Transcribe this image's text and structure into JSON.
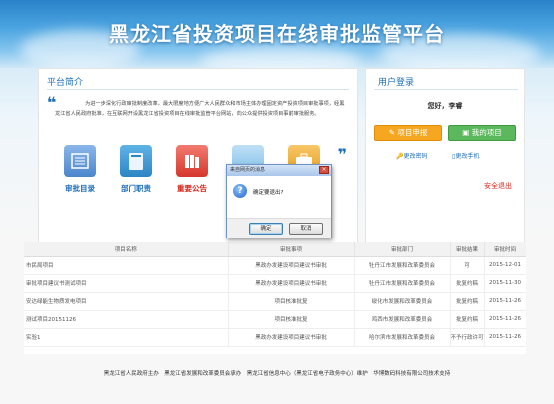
{
  "header": {
    "title": "黑龙江省投资项目在线审批监管平台"
  },
  "intro": {
    "title": "平台简介",
    "text": "为进一步深化行政审批制度改革，最大限度地方便广大人民群众和市场主体办理固定资产投资项目审批事项，经黑龙江省人民政府批准，在互联网开设黑龙江省投资项目在线审批监管平台网站，向公众提供投资项目事前审批服务。",
    "icons": [
      {
        "label": "审批目录",
        "color": "#3b82d1",
        "icon": "catalog-icon"
      },
      {
        "label": "部门职责",
        "color": "#2d9ad6",
        "icon": "book-icon"
      },
      {
        "label": "重要公告",
        "color": "#e0443a",
        "icon": "notice-icon"
      },
      {
        "label": "",
        "color": "#6fb6e6",
        "icon": "partial-icon"
      },
      {
        "label": "",
        "color": "#f2b134",
        "icon": "briefcase-icon"
      }
    ]
  },
  "user": {
    "title": "用户登录",
    "greeting": "您好，李睿",
    "apply_label": "项目申报",
    "my_projects_label": "我的项目",
    "change_password": "更改密码",
    "change_phone": "更改手机",
    "logout": "安全退出"
  },
  "table": {
    "headers": [
      "项目名称",
      "审批事项",
      "审批部门",
      "审批结果",
      "审批时间"
    ],
    "rows": [
      [
        "市民局项目",
        "黑政办发建设项目建议书审批",
        "牡丹江市发展和改革委员会",
        "可",
        "2015-12-01"
      ],
      [
        "审批项目建议书测试项目",
        "黑政办发建设项目建议书审批",
        "牡丹江市发展和改革委员会",
        "批复约稿",
        "2015-11-30"
      ],
      [
        "安达绿能生物质发电项目",
        "项目核准批复",
        "绥化市发展和改革委员会",
        "批复约稿",
        "2015-11-26"
      ],
      [
        "测试项目20151126",
        "项目核准批复",
        "鸡西市发展和改革委员会",
        "批复约稿",
        "2015-11-26"
      ],
      [
        "实验1",
        "黑政办发建设项目建议书审批",
        "哈尔滨市发展和改革委员会",
        "不予行政许可",
        "2015-11-26"
      ]
    ]
  },
  "footer": {
    "text": "黑龙江省人民政府主办　黑龙江省发展和改革委员会承办　黑龙江省信息中心（黑龙江省电子政务中心）维护　华博数码科技有限公司技术支持"
  },
  "dialog": {
    "title": "来自网页的消息",
    "message": "确定要退出?",
    "ok_label": "确定",
    "cancel_label": "取消",
    "close_glyph": "×",
    "icon_glyph": "?"
  }
}
